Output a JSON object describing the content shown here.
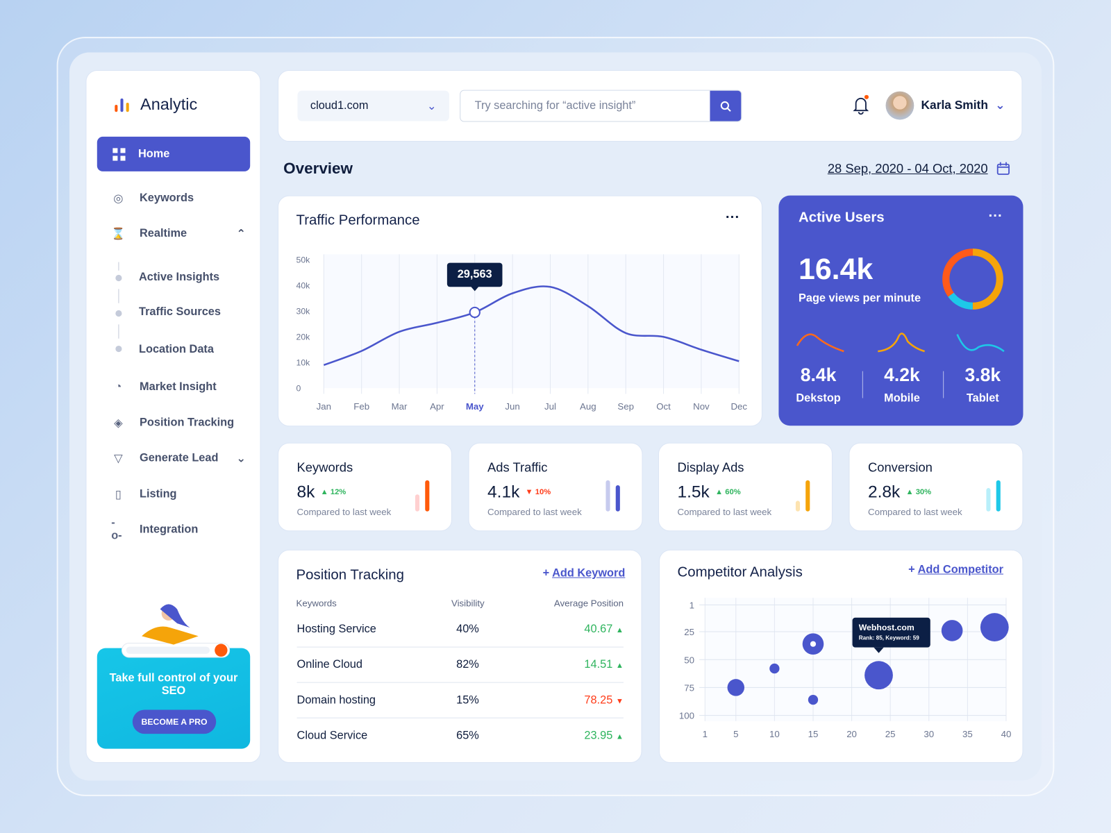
{
  "app": {
    "name": "Analytic"
  },
  "sidebar": {
    "items": [
      {
        "label": "Home",
        "icon": "grid-icon"
      },
      {
        "label": "Keywords",
        "icon": "target-icon"
      },
      {
        "label": "Realtime",
        "icon": "hourglass-icon"
      },
      {
        "label": "Active Insights"
      },
      {
        "label": "Traffic Sources"
      },
      {
        "label": "Location Data"
      },
      {
        "label": "Market Insight",
        "icon": "pie-icon"
      },
      {
        "label": "Position Tracking",
        "icon": "layers-icon"
      },
      {
        "label": "Generate Lead",
        "icon": "filter-icon"
      },
      {
        "label": "Listing",
        "icon": "clipboard-icon"
      },
      {
        "label": "Integration",
        "icon": "commit-icon"
      }
    ],
    "promo": {
      "title": "Take full control of your SEO",
      "button": "BECOME A PRO"
    }
  },
  "header": {
    "site": "cloud1.com",
    "search_placeholder": "Try searching for “active insight”",
    "user": "Karla Smith"
  },
  "overview": {
    "title": "Overview",
    "date_range": "28 Sep, 2020 - 04 Oct, 2020"
  },
  "traffic": {
    "title": "Traffic Performance",
    "tooltip": "29,563"
  },
  "active_users": {
    "title": "Active Users",
    "value": "16.4k",
    "caption": "Page views per minute",
    "devices": [
      {
        "value": "8.4k",
        "label": "Dekstop",
        "color": "#ff6a1a"
      },
      {
        "value": "4.2k",
        "label": "Mobile",
        "color": "#f5a40a"
      },
      {
        "value": "3.8k",
        "label": "Tablet",
        "color": "#1ec8e8"
      }
    ],
    "donut": [
      {
        "share": 0.5,
        "color": "#f5a40a"
      },
      {
        "share": 0.15,
        "color": "#1ec8e8"
      },
      {
        "share": 0.35,
        "color": "#ff5a1a"
      }
    ]
  },
  "kpis": [
    {
      "title": "Keywords",
      "value": "8k",
      "change": "12%",
      "dir": "up",
      "caption": "Compared to last week",
      "color": "#ff5a0a",
      "light": "#ffd0d0",
      "level": [
        0.55,
        1
      ]
    },
    {
      "title": "Ads Traffic",
      "value": "4.1k",
      "change": "10%",
      "dir": "down",
      "caption": "Compared to last week",
      "color": "#4a56cc",
      "light": "#c7cbee",
      "level": [
        1,
        0.85
      ]
    },
    {
      "title": "Display Ads",
      "value": "1.5k",
      "change": "60%",
      "dir": "up",
      "caption": "Compared to last week",
      "color": "#f5a40a",
      "light": "#fde3b0",
      "level": [
        0.35,
        1
      ]
    },
    {
      "title": "Conversion",
      "value": "2.8k",
      "change": "30%",
      "dir": "up",
      "caption": "Compared to last week",
      "color": "#1ec8e8",
      "light": "#b9effa",
      "level": [
        0.75,
        1
      ]
    }
  ],
  "position_tracking": {
    "title": "Position Tracking",
    "add": "Add Keyword",
    "columns": [
      "Keywords",
      "Visibility",
      "Average Position"
    ],
    "rows": [
      {
        "keyword": "Hosting Service",
        "visibility": "40%",
        "position": "40.67",
        "dir": "up"
      },
      {
        "keyword": "Online Cloud",
        "visibility": "82%",
        "position": "14.51",
        "dir": "up"
      },
      {
        "keyword": "Domain hosting",
        "visibility": "15%",
        "position": "78.25",
        "dir": "down"
      },
      {
        "keyword": "Cloud Service",
        "visibility": "65%",
        "position": "23.95",
        "dir": "up"
      }
    ]
  },
  "competitor": {
    "title": "Competitor Analysis",
    "add": "Add Competitor",
    "tooltip_title": "Webhost.com",
    "tooltip_text": "Rank: 85, Keyword: 59"
  },
  "chart_data": [
    {
      "type": "line",
      "title": "Traffic Performance",
      "categories": [
        "Jan",
        "Feb",
        "Mar",
        "Apr",
        "May",
        "Jun",
        "Jul",
        "Aug",
        "Sep",
        "Oct",
        "Nov",
        "Dec"
      ],
      "values": [
        9000,
        14500,
        22000,
        25500,
        29563,
        37000,
        39500,
        32000,
        21500,
        20000,
        15000,
        10500
      ],
      "yticks": [
        "0",
        "10k",
        "20k",
        "30k",
        "40k",
        "50k"
      ],
      "ylim": [
        0,
        50000
      ],
      "highlight": "May",
      "grid": "vertical",
      "color": "#4a56cc"
    },
    {
      "type": "scatter",
      "title": "Competitor Analysis",
      "xticks": [
        1,
        5,
        10,
        15,
        20,
        25,
        30,
        35,
        40
      ],
      "yticks": [
        1,
        25,
        50,
        75,
        100
      ],
      "xlim": [
        1,
        40
      ],
      "ylim": [
        1,
        100
      ],
      "y_inverted": true,
      "grid": true,
      "points": [
        {
          "x": 5,
          "y": 75,
          "size": 3
        },
        {
          "x": 10,
          "y": 58,
          "size": 2
        },
        {
          "x": 15,
          "y": 36,
          "size": 4,
          "highlight": true
        },
        {
          "x": 15,
          "y": 86,
          "size": 2
        },
        {
          "x": 23.5,
          "y": 64,
          "size": 5,
          "label": "Webhost.com"
        },
        {
          "x": 33,
          "y": 24,
          "size": 4
        },
        {
          "x": 38.5,
          "y": 21,
          "size": 5
        }
      ],
      "color": "#4a56cc"
    }
  ]
}
